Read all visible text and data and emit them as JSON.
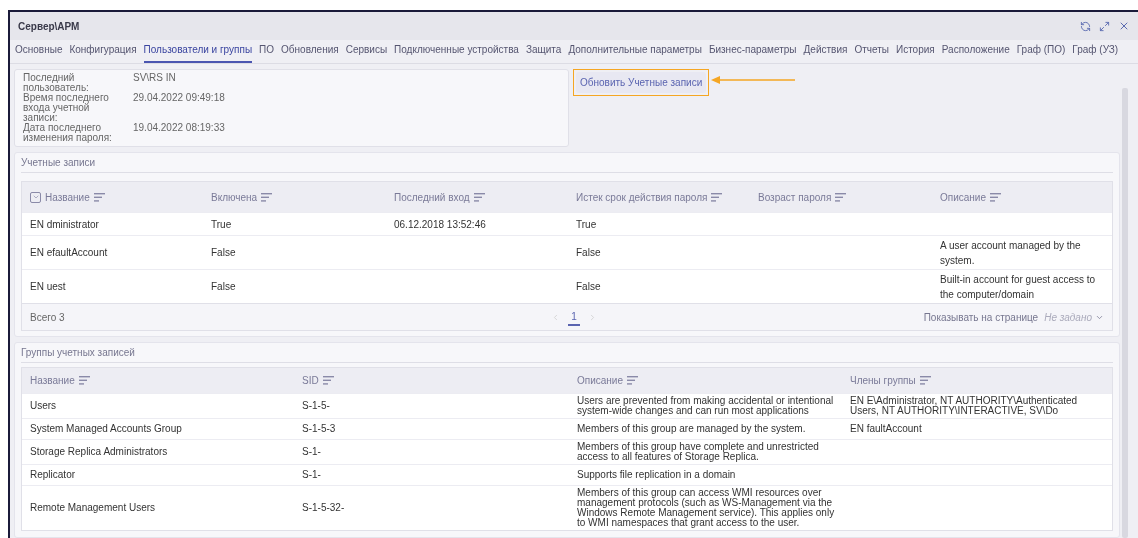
{
  "window": {
    "title": "Сервер\\АРМ"
  },
  "tabs": [
    {
      "label": "Основные",
      "selected": false
    },
    {
      "label": "Конфигурация",
      "selected": false
    },
    {
      "label": "Пользователи и группы",
      "selected": true
    },
    {
      "label": "ПО",
      "selected": false
    },
    {
      "label": "Обновления",
      "selected": false
    },
    {
      "label": "Сервисы",
      "selected": false
    },
    {
      "label": "Подключенные устройства",
      "selected": false
    },
    {
      "label": "Защита",
      "selected": false
    },
    {
      "label": "Дополнительные параметры",
      "selected": false
    },
    {
      "label": "Бизнес-параметры",
      "selected": false
    },
    {
      "label": "Действия",
      "selected": false
    },
    {
      "label": "Отчеты",
      "selected": false
    },
    {
      "label": "История",
      "selected": false
    },
    {
      "label": "Расположение",
      "selected": false
    },
    {
      "label": "Граф (ПО)",
      "selected": false
    },
    {
      "label": "Граф (УЗ)",
      "selected": false
    }
  ],
  "info": [
    {
      "label": "Последний пользователь:",
      "value": "SV\\RS IN"
    },
    {
      "label": "Время последнего входа учетной записи:",
      "value": "29.04.2022 09:49:18"
    },
    {
      "label": "Дата последнего изменения пароля:",
      "value": "19.04.2022 08:19:33"
    }
  ],
  "refresh_button": "Обновить Учетные записи",
  "accounts": {
    "title": "Учетные записи",
    "columns": [
      "Название",
      "Включена",
      "Последний вход",
      "Истек срок действия пароля",
      "Возраст пароля",
      "Описание"
    ],
    "rows": [
      [
        "EN dministrator",
        "True",
        "06.12.2018 13:52:46",
        "True",
        "",
        ""
      ],
      [
        "EN efaultAccount",
        "False",
        "",
        "False",
        "",
        "A user account managed by the system."
      ],
      [
        "EN uest",
        "False",
        "",
        "False",
        "",
        "Built-in account for guest access to the computer/domain"
      ]
    ],
    "total": "Всего 3",
    "pages": [
      {
        "label": "1",
        "selected": true
      }
    ],
    "per_page_label": "Показывать на странице",
    "per_page_value": "Не задано"
  },
  "groups": {
    "title": "Группы учетных записей",
    "columns": [
      "Название",
      "SID",
      "Описание",
      "Члены группы"
    ],
    "rows": [
      [
        "Users",
        "S-1-5-",
        "Users are prevented from making accidental or intentional system-wide changes and can run most applications",
        "EN E\\Administrator, NT AUTHORITY\\Authenticated Users, NT AUTHORITY\\INTERACTIVE, SV\\Do"
      ],
      [
        "System Managed Accounts Group",
        "S-1-5-3",
        "Members of this group are managed by the system.",
        "EN faultAccount"
      ],
      [
        "Storage Replica Administrators",
        "S-1-",
        "Members of this group have complete and unrestricted access to all features of Storage Replica.",
        ""
      ],
      [
        "Replicator",
        "S-1-",
        "Supports file replication in a domain",
        ""
      ],
      [
        "Remote Management Users",
        "S-1-5-32-",
        "Members of this group can access WMI resources over management protocols (such as WS-Management via the Windows Remote Management service). This applies only to WMI namespaces that grant access to the user.",
        ""
      ]
    ]
  }
}
